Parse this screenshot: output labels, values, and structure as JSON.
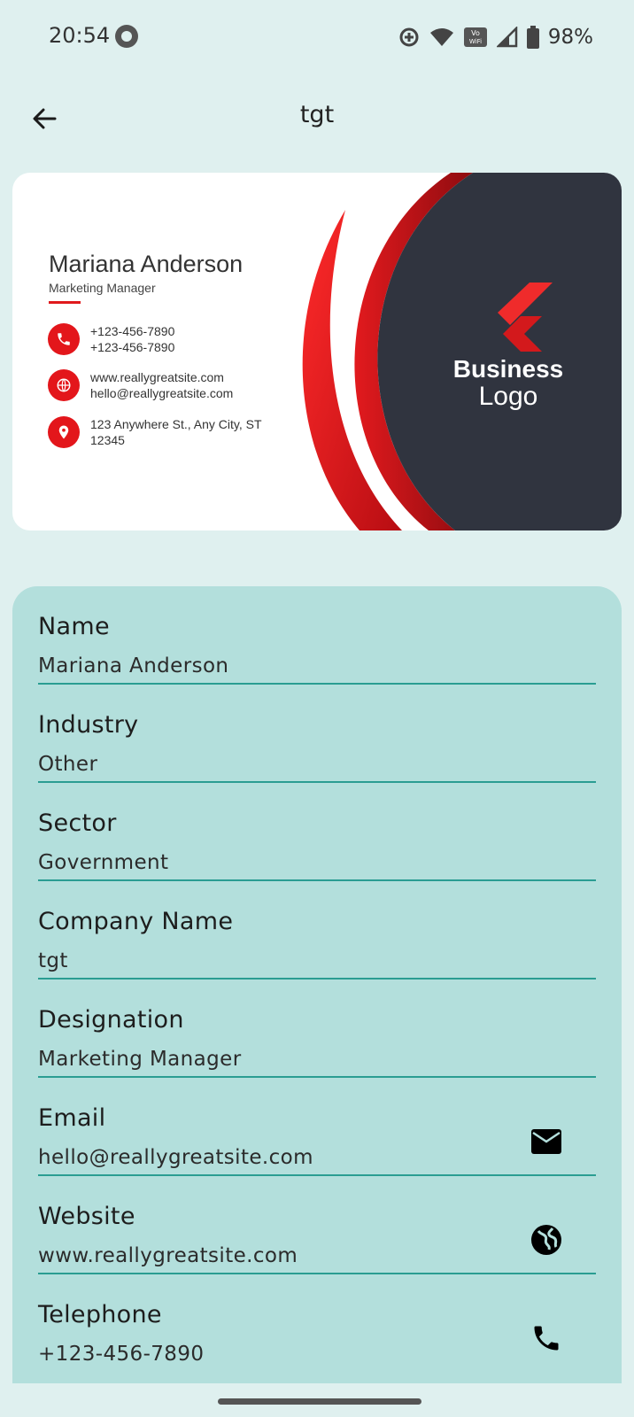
{
  "status_bar": {
    "time": "20:54",
    "battery": "98%",
    "icons": [
      "data-saver-icon",
      "wifi-icon",
      "vowifi-icon",
      "signal-icon",
      "battery-icon"
    ]
  },
  "app_bar": {
    "title": "tgt"
  },
  "card": {
    "name": "Mariana Anderson",
    "role": "Marketing Manager",
    "phone_line1": "+123-456-7890",
    "phone_line2": "+123-456-7890",
    "web_line1": "www.reallygreatsite.com",
    "web_line2": "hello@reallygreatsite.com",
    "addr_line1": "123 Anywhere St., Any City, ST",
    "addr_line2": "12345",
    "logo_business": "Business",
    "logo_logo": "Logo",
    "colors": {
      "accent": "#e3161b",
      "dark": "#30343f"
    }
  },
  "fields": {
    "name": {
      "label": "Name",
      "value": "Mariana Anderson"
    },
    "industry": {
      "label": "Industry",
      "value": "Other"
    },
    "sector": {
      "label": "Sector",
      "value": "Government"
    },
    "company": {
      "label": "Company Name",
      "value": "tgt"
    },
    "designation": {
      "label": "Designation",
      "value": "Marketing Manager"
    },
    "email": {
      "label": "Email",
      "value": "hello@reallygreatsite.com",
      "icon": "mail-icon"
    },
    "website": {
      "label": "Website",
      "value": "www.reallygreatsite.com",
      "icon": "globe-icon"
    },
    "telephone": {
      "label": "Telephone",
      "value": "+123-456-7890",
      "icon": "phone-icon"
    }
  }
}
